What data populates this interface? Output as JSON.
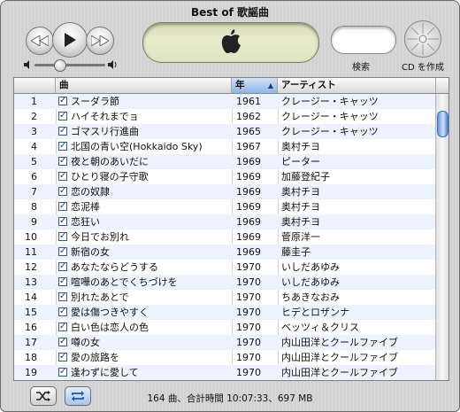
{
  "window": {
    "title": "Best of 歌謡曲"
  },
  "controls": {
    "search_label": "検索",
    "burn_label": "CD を作成",
    "volume_level": 0.35
  },
  "columns": {
    "song": "曲",
    "year": "年",
    "artist": "アーティスト"
  },
  "rows": [
    {
      "num": "1",
      "song": "スーダラ節",
      "year": "1961",
      "artist": "クレージー・キャッツ"
    },
    {
      "num": "2",
      "song": "ハイそれまでョ",
      "year": "1962",
      "artist": "クレージー・キャッツ"
    },
    {
      "num": "3",
      "song": "ゴマスリ行進曲",
      "year": "1965",
      "artist": "クレージー・キャッツ"
    },
    {
      "num": "4",
      "song": "北国の青い空(Hokkaido Sky)",
      "year": "1967",
      "artist": "奥村チヨ"
    },
    {
      "num": "5",
      "song": "夜と朝のあいだに",
      "year": "1969",
      "artist": "ピーター"
    },
    {
      "num": "6",
      "song": "ひとり寝の子守歌",
      "year": "1969",
      "artist": "加藤登紀子"
    },
    {
      "num": "7",
      "song": "恋の奴隷",
      "year": "1969",
      "artist": "奥村チヨ"
    },
    {
      "num": "8",
      "song": "恋泥棒",
      "year": "1969",
      "artist": "奥村チヨ"
    },
    {
      "num": "9",
      "song": "恋狂い",
      "year": "1969",
      "artist": "奥村チヨ"
    },
    {
      "num": "10",
      "song": "今日でお別れ",
      "year": "1969",
      "artist": "菅原洋一"
    },
    {
      "num": "11",
      "song": "新宿の女",
      "year": "1969",
      "artist": "藤圭子"
    },
    {
      "num": "12",
      "song": "あなたならどうする",
      "year": "1970",
      "artist": "いしだあゆみ"
    },
    {
      "num": "13",
      "song": "喧嘩のあとでくちづけを",
      "year": "1970",
      "artist": "いしだあゆみ"
    },
    {
      "num": "14",
      "song": "別れたあとで",
      "year": "1970",
      "artist": "ちあきなおみ"
    },
    {
      "num": "15",
      "song": "愛は傷つきやすく",
      "year": "1970",
      "artist": "ヒデとロザンナ"
    },
    {
      "num": "16",
      "song": "白い色は恋人の色",
      "year": "1970",
      "artist": "ベッツィ＆クリス"
    },
    {
      "num": "17",
      "song": "噂の女",
      "year": "1970",
      "artist": "内山田洋とクールファイブ"
    },
    {
      "num": "18",
      "song": "愛の旅路を",
      "year": "1970",
      "artist": "内山田洋とクールファイブ"
    },
    {
      "num": "19",
      "song": "逢わずに愛して",
      "year": "1970",
      "artist": "内山田洋とクールファイブ"
    }
  ],
  "status": "164 曲、合計時間 10:07:33、697 MB",
  "icons": {
    "prev": "rewind-icon",
    "play": "play-icon",
    "next": "fast-forward-icon",
    "lcd": "apple-logo-icon",
    "burn": "burn-disc-icon",
    "shuffle": "shuffle-icon",
    "repeat": "repeat-icon"
  },
  "colors": {
    "accent": "#3e6db5",
    "row_stripe": "#edf3fe",
    "lcd": "#e1e6c4"
  }
}
